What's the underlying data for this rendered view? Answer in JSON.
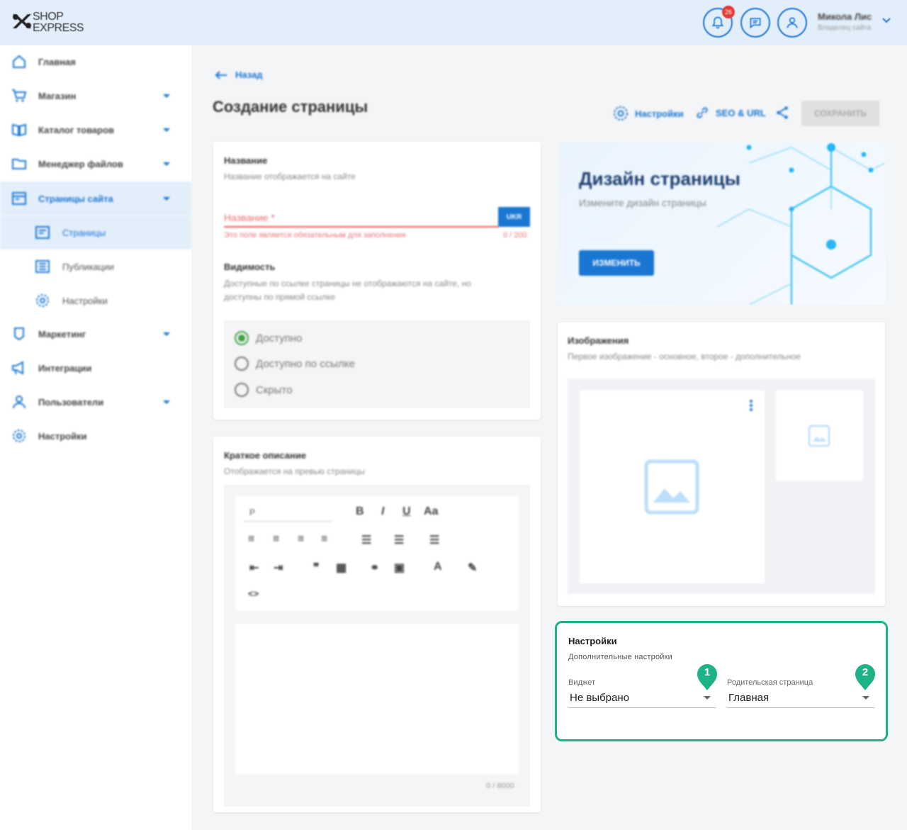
{
  "header": {
    "logo_line1": "SHOP",
    "logo_line2": "EXPRESS",
    "notifications_count": "26",
    "user_name": "Микола Лис",
    "user_role": "Владелец сайта"
  },
  "sidebar": {
    "items": [
      {
        "label": "Главная",
        "icon": "home-icon",
        "has_caret": false
      },
      {
        "label": "Магазин",
        "icon": "cart-icon",
        "has_caret": true
      },
      {
        "label": "Каталог товаров",
        "icon": "book-icon",
        "has_caret": true
      },
      {
        "label": "Менеджер файлов",
        "icon": "folder-icon",
        "has_caret": true
      },
      {
        "label": "Страницы сайта",
        "icon": "pages-icon",
        "has_caret": true,
        "active": true
      },
      {
        "label": "Маркетинг",
        "icon": "marketing-icon",
        "has_caret": true
      },
      {
        "label": "Интеграции",
        "icon": "megaphone-icon",
        "has_caret": false
      },
      {
        "label": "Пользователи",
        "icon": "users-icon",
        "has_caret": true
      },
      {
        "label": "Настройки",
        "icon": "gear-icon",
        "has_caret": false
      }
    ],
    "subitems": [
      {
        "label": "Страницы",
        "icon": "page-icon",
        "active": true
      },
      {
        "label": "Публикации",
        "icon": "news-icon"
      },
      {
        "label": "Настройки",
        "icon": "gear-icon"
      }
    ]
  },
  "main": {
    "back_label": "Назад",
    "page_title": "Создание страницы",
    "toolbar": {
      "settings_label": "Настройки",
      "seo_label": "SEO & URL",
      "save_label": "СОХРАНИТЬ"
    },
    "name_card": {
      "title": "Название",
      "subtitle": "Название отображается на сайте",
      "input_label": "Название *",
      "lang_button": "UKR",
      "error": "Это поле является обязательным для заполнения",
      "counter": "0 / 200"
    },
    "visibility": {
      "title": "Видимость",
      "subtitle_line1": "Доступные по ссылке страницы не отображаются на сайте, но",
      "subtitle_line2": "доступны по прямой ссылке",
      "options": [
        "Доступно",
        "Доступно по ссылке",
        "Скрыто"
      ],
      "selected": "Доступно"
    },
    "description_card": {
      "title": "Краткое описание",
      "subtitle": "Отображается на превью страницы",
      "format_select": "P",
      "counter": "0 / 8000"
    },
    "design_card": {
      "title": "Дизайн страницы",
      "subtitle": "Измените дизайн страницы",
      "button": "ИЗМЕНИТЬ"
    },
    "images_card": {
      "title": "Изображения",
      "subtitle": "Первое изображение - основное, второе - дополнительное"
    },
    "settings_card": {
      "title": "Настройки",
      "subtitle": "Дополнительные настройки",
      "widget_label": "Виджет",
      "widget_value": "Не выбрано",
      "parent_label": "Родительская страница",
      "parent_value": "Главная",
      "marker1": "1",
      "marker2": "2"
    }
  },
  "colors": {
    "accent": "#1976d2",
    "highlight": "#1db386",
    "error": "#ef5350"
  }
}
